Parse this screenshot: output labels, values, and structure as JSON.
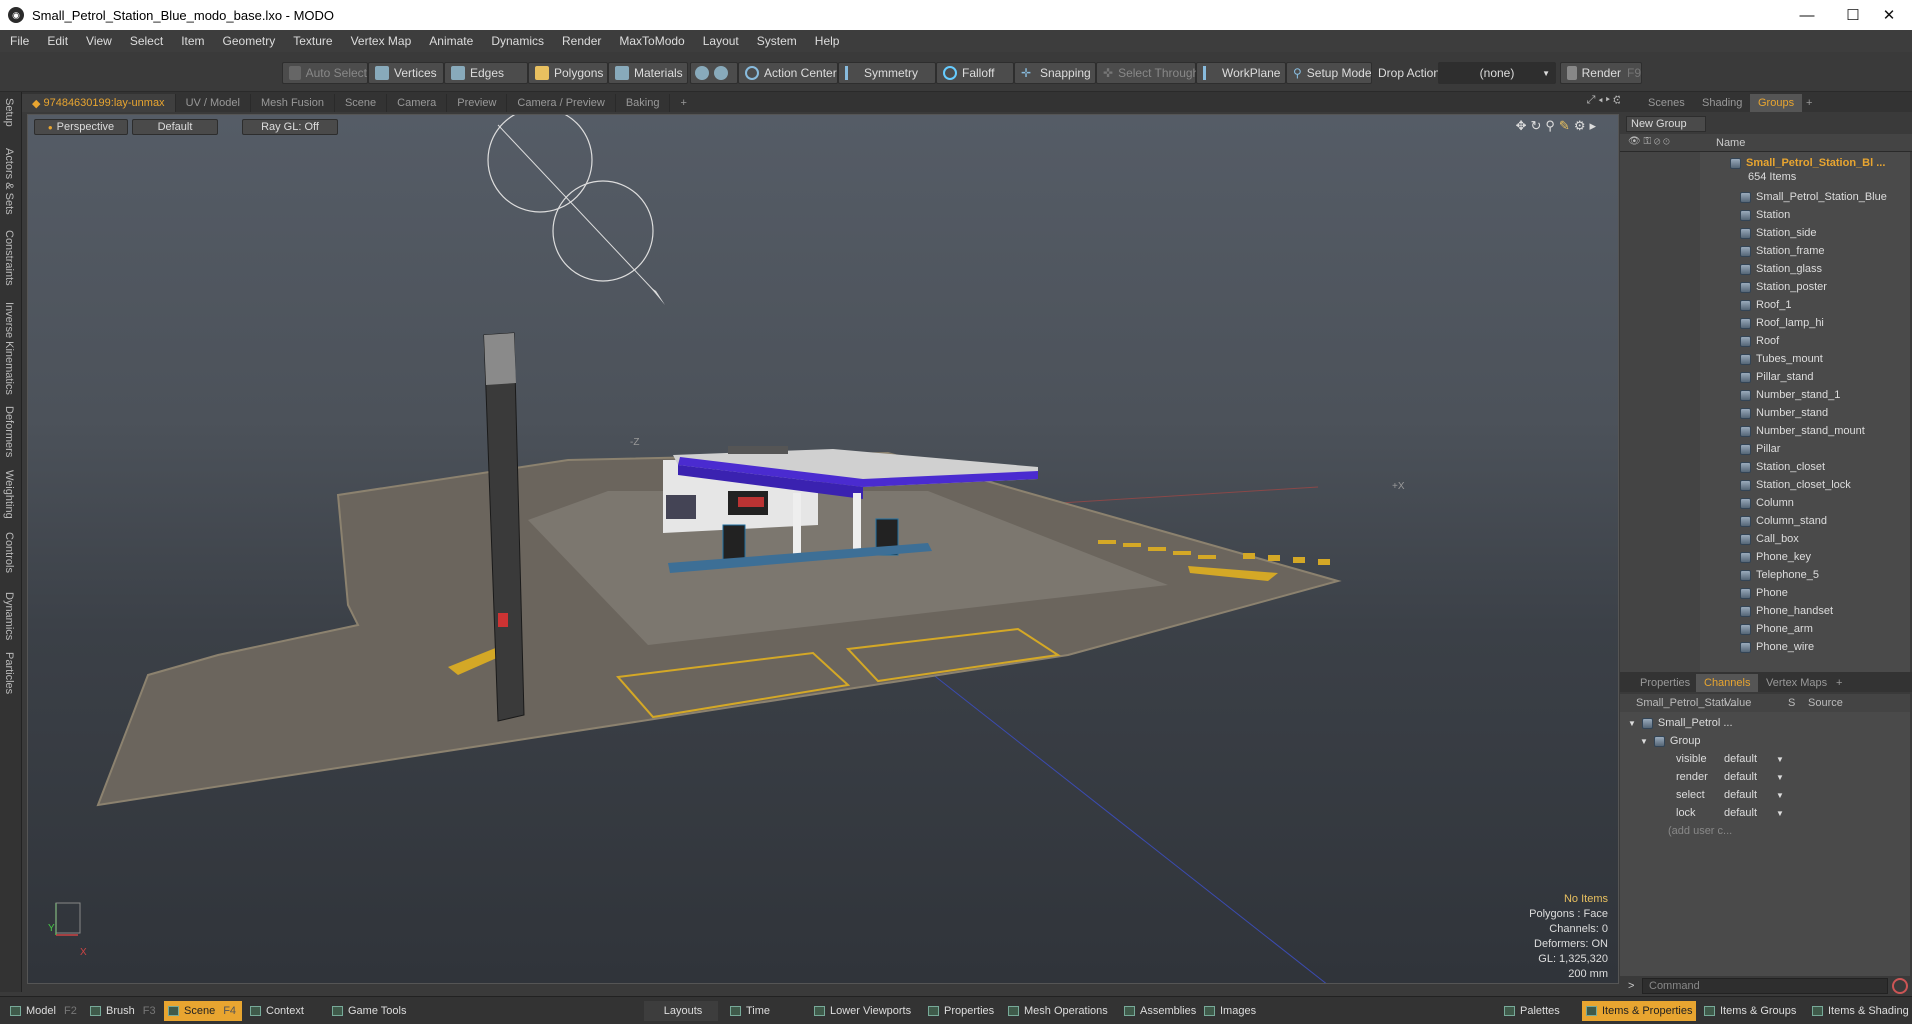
{
  "window": {
    "title": "Small_Petrol_Station_Blue_modo_base.lxo - MODO",
    "minimize": "—",
    "maximize": "☐",
    "close": "✕"
  },
  "menu": [
    "File",
    "Edit",
    "View",
    "Select",
    "Item",
    "Geometry",
    "Texture",
    "Vertex Map",
    "Animate",
    "Dynamics",
    "Render",
    "MaxToModo",
    "Layout",
    "System",
    "Help"
  ],
  "toolbar": {
    "auto_select": "Auto Select",
    "vertices": "Vertices",
    "edges": "Edges",
    "polygons": "Polygons",
    "materials": "Materials",
    "action_center": "Action Center",
    "symmetry": "Symmetry",
    "falloff": "Falloff",
    "snapping": "Snapping",
    "select_through": "Select Through",
    "workplane": "WorkPlane",
    "setup_mode": "Setup Mode",
    "drop_action_label": "Drop Action",
    "drop_action_value": "(none)",
    "render": "Render",
    "render_key": "F9"
  },
  "left_tabs": [
    "Setup",
    "Actors & Sets",
    "Constraints",
    "Inverse Kinematics",
    "Deformers",
    "Weighting",
    "Controls",
    "Dynamics",
    "Particles"
  ],
  "viewport_tabs": [
    "97484630199:lay-unmax",
    "UV / Model",
    "Mesh Fusion",
    "Scene",
    "Camera",
    "Preview",
    "Camera / Preview",
    "Baking",
    "+"
  ],
  "viewport": {
    "projection": "Perspective",
    "shading": "Default",
    "raygl": "Ray GL: Off",
    "hud": {
      "selection": "No Items",
      "polygons": "Polygons : Face",
      "channels": "Channels: 0",
      "deformers": "Deformers: ON",
      "gl": "GL: 1,325,320",
      "scale": "200 mm"
    },
    "axis_x": "X",
    "axis_y": "Y",
    "label_z": "-Z",
    "label_x": "+X"
  },
  "right_panel": {
    "tabs": [
      "Scenes",
      "Shading",
      "Groups",
      "+"
    ],
    "new_group": "New Group",
    "name_header": "Name",
    "group_name": "Small_Petrol_Station_Bl ...",
    "group_count": "654 Items",
    "items": [
      "Small_Petrol_Station_Blue",
      "Station",
      "Station_side",
      "Station_frame",
      "Station_glass",
      "Station_poster",
      "Roof_1",
      "Roof_lamp_hi",
      "Roof",
      "Tubes_mount",
      "Pillar_stand",
      "Number_stand_1",
      "Number_stand",
      "Number_stand_mount",
      "Pillar",
      "Station_closet",
      "Station_closet_lock",
      "Column",
      "Column_stand",
      "Call_box",
      "Phone_key",
      "Telephone_5",
      "Phone",
      "Phone_handset",
      "Phone_arm",
      "Phone_wire"
    ]
  },
  "channels_panel": {
    "tabs": [
      "Properties",
      "Channels",
      "Vertex Maps",
      "+"
    ],
    "col_name": "Small_Petrol_Stati...",
    "col_value": "Value",
    "col_s": "S",
    "col_source": "Source",
    "root": "Small_Petrol ...",
    "group": "Group",
    "rows": [
      {
        "name": "visible",
        "value": "default"
      },
      {
        "name": "render",
        "value": "default"
      },
      {
        "name": "select",
        "value": "default"
      },
      {
        "name": "lock",
        "value": "default"
      }
    ],
    "add_user": "(add user c...",
    "command_placeholder": "Command"
  },
  "statusbar": {
    "model": "Model",
    "model_key": "F2",
    "brush": "Brush",
    "brush_key": "F3",
    "scene": "Scene",
    "scene_key": "F4",
    "context": "Context",
    "game_tools": "Game Tools",
    "layouts": "Layouts",
    "time": "Time",
    "lower_viewports": "Lower Viewports",
    "properties": "Properties",
    "mesh_operations": "Mesh Operations",
    "assemblies": "Assemblies",
    "images": "Images",
    "palettes": "Palettes",
    "items_properties": "Items & Properties",
    "items_groups": "Items & Groups",
    "items_shading": "Items & Shading"
  },
  "colors": {
    "accent": "#e8a530",
    "roof_blue": "#4a2bd0"
  }
}
